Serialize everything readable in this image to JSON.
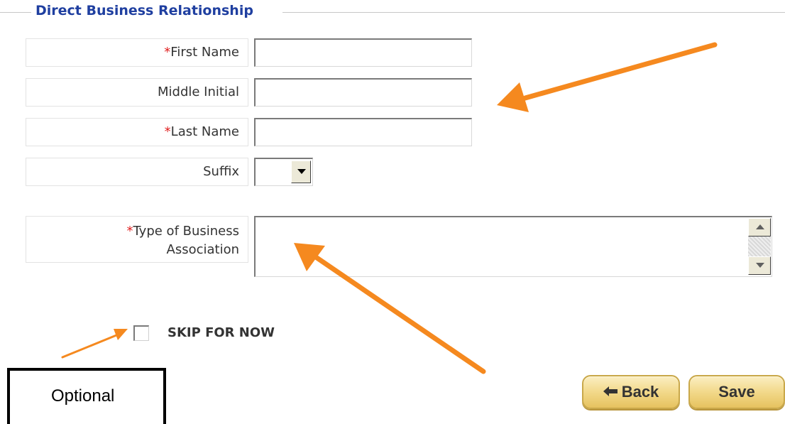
{
  "section": {
    "legend": "Direct Business Relationship"
  },
  "fields": {
    "first_name": {
      "required_mark": "*",
      "label": "First Name",
      "value": ""
    },
    "middle_initial": {
      "label": "Middle Initial",
      "value": ""
    },
    "last_name": {
      "required_mark": "*",
      "label": "Last Name",
      "value": ""
    },
    "suffix": {
      "label": "Suffix",
      "selected": ""
    },
    "business_type": {
      "required_mark": "*",
      "label_line1": "Type of Business",
      "label_line2": "Association",
      "value": ""
    }
  },
  "skip": {
    "label": "SKIP FOR NOW",
    "checked": false
  },
  "annotation": {
    "callout_text": "Optional",
    "arrow_color": "#f5891f"
  },
  "buttons": {
    "back_label": "Back",
    "save_label": "Save"
  },
  "colors": {
    "legend": "#1f3fa0",
    "required": "#e02020",
    "button_gold": "#f2d98a"
  },
  "icons": {
    "back": "left-arrow-icon",
    "dropdown": "chevron-down-icon"
  }
}
